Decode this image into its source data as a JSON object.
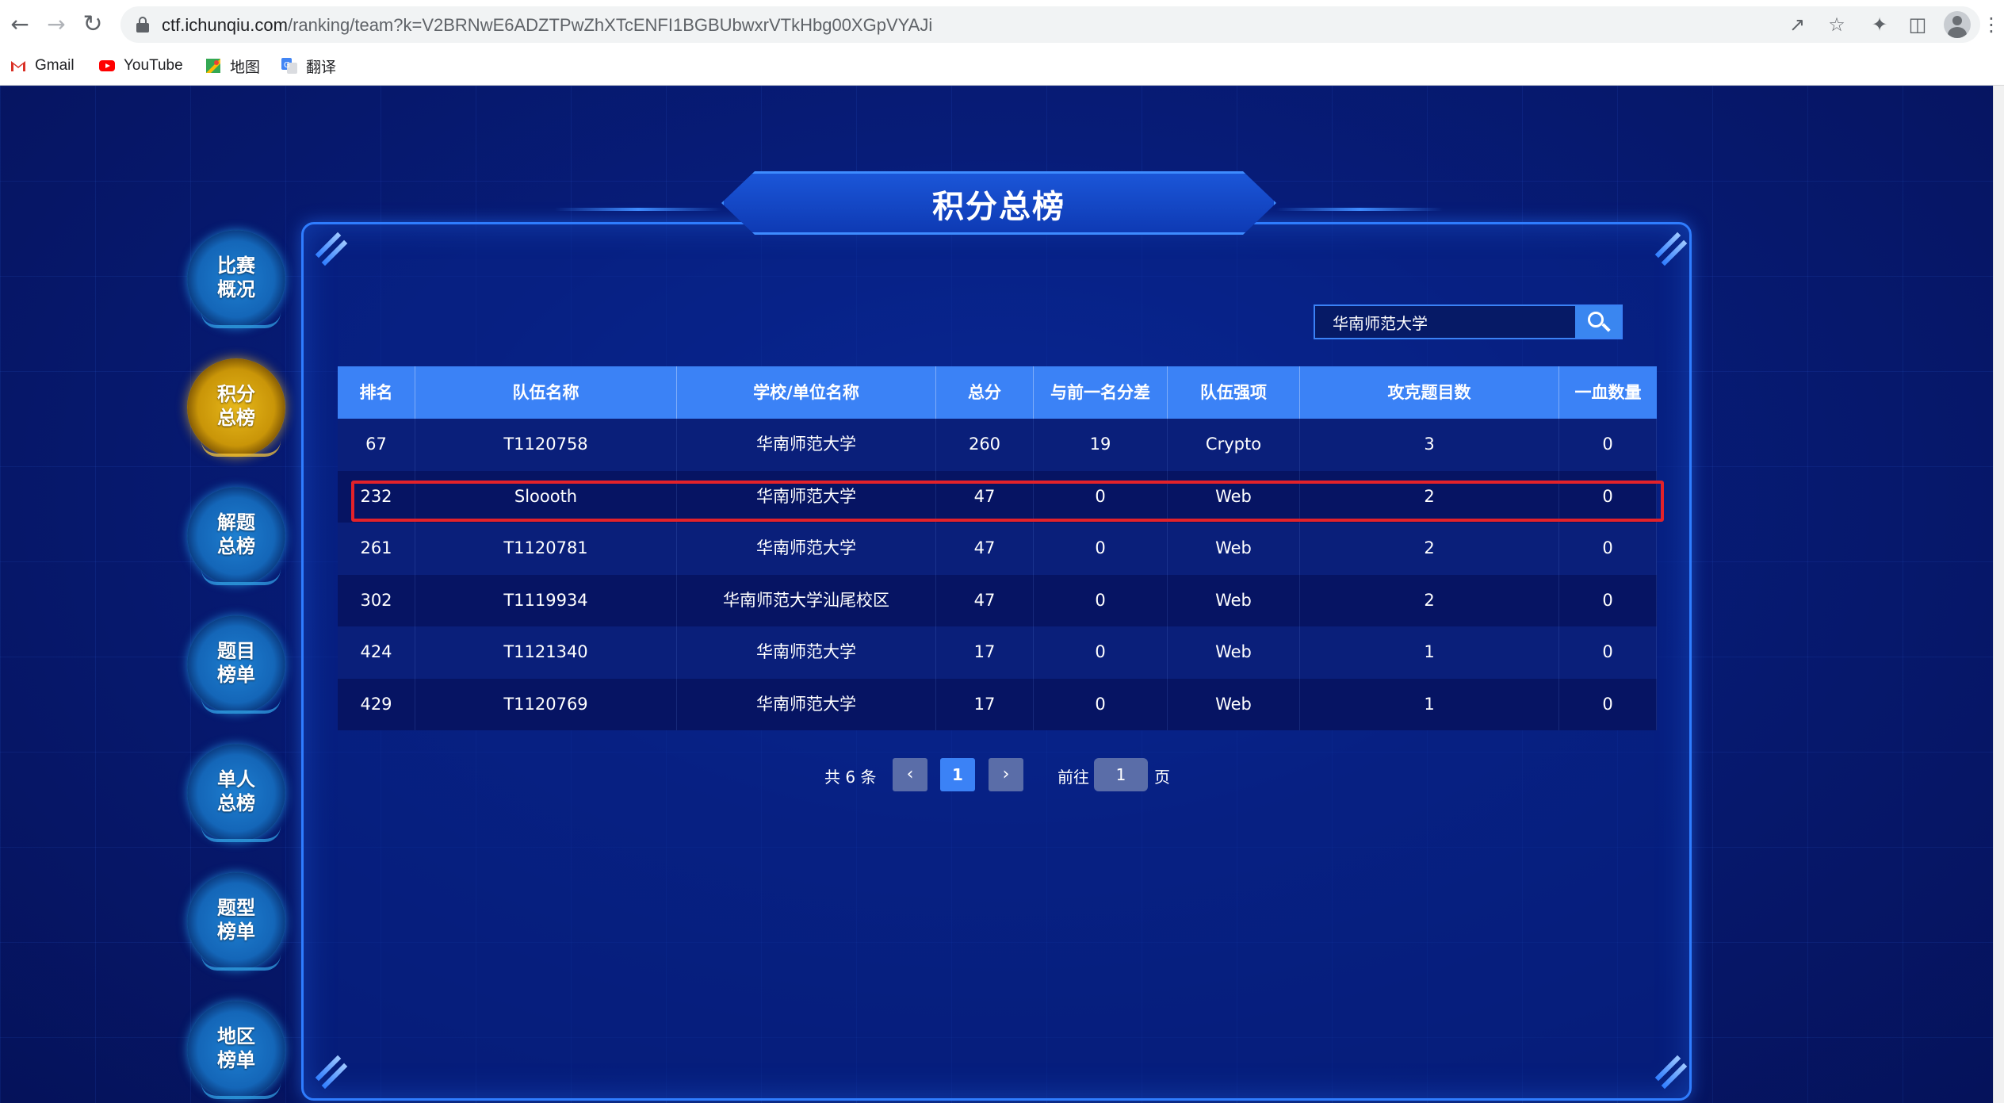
{
  "browser": {
    "url_host": "ctf.ichunqiu.com",
    "url_path": "/ranking/team?k=V2BRNwE6ADZTPwZhXTcENFI1BGBUbwxrVTkHbg00XGpVYAJi",
    "bookmarks": [
      {
        "label": "Gmail",
        "icon": "gmail-icon"
      },
      {
        "label": "YouTube",
        "icon": "youtube-icon"
      },
      {
        "label": "地图",
        "icon": "maps-icon"
      },
      {
        "label": "翻译",
        "icon": "translate-icon"
      }
    ]
  },
  "page": {
    "title": "积分总榜",
    "side_nav": [
      {
        "label": "比赛\n概况",
        "active": false
      },
      {
        "label": "积分\n总榜",
        "active": true
      },
      {
        "label": "解题\n总榜",
        "active": false
      },
      {
        "label": "题目\n榜单",
        "active": false
      },
      {
        "label": "单人\n总榜",
        "active": false
      },
      {
        "label": "题型\n榜单",
        "active": false
      },
      {
        "label": "地区\n榜单",
        "active": false
      }
    ],
    "search": {
      "value": "华南师范大学"
    },
    "table": {
      "headers": [
        "排名",
        "队伍名称",
        "学校/单位名称",
        "总分",
        "与前一名分差",
        "队伍强项",
        "攻克题目数",
        "一血数量"
      ],
      "rows": [
        [
          "67",
          "T1120758",
          "华南师范大学",
          "260",
          "19",
          "Crypto",
          "3",
          "0"
        ],
        [
          "232",
          "Sloooth",
          "华南师范大学",
          "47",
          "0",
          "Web",
          "2",
          "0"
        ],
        [
          "261",
          "T1120781",
          "华南师范大学",
          "47",
          "0",
          "Web",
          "2",
          "0"
        ],
        [
          "302",
          "T1119934",
          "华南师范大学汕尾校区",
          "47",
          "0",
          "Web",
          "2",
          "0"
        ],
        [
          "424",
          "T1121340",
          "华南师范大学",
          "17",
          "0",
          "Web",
          "1",
          "0"
        ],
        [
          "429",
          "T1120769",
          "华南师范大学",
          "17",
          "0",
          "Web",
          "1",
          "0"
        ]
      ]
    },
    "pagination": {
      "total": "共 6 条",
      "current": "1",
      "goto_prefix": "前往",
      "goto_value": "1",
      "goto_suffix": "页"
    }
  },
  "colors": {
    "accent": "#3b82f6",
    "highlight": "#e3222a",
    "active_nav": "#e7b81b"
  }
}
